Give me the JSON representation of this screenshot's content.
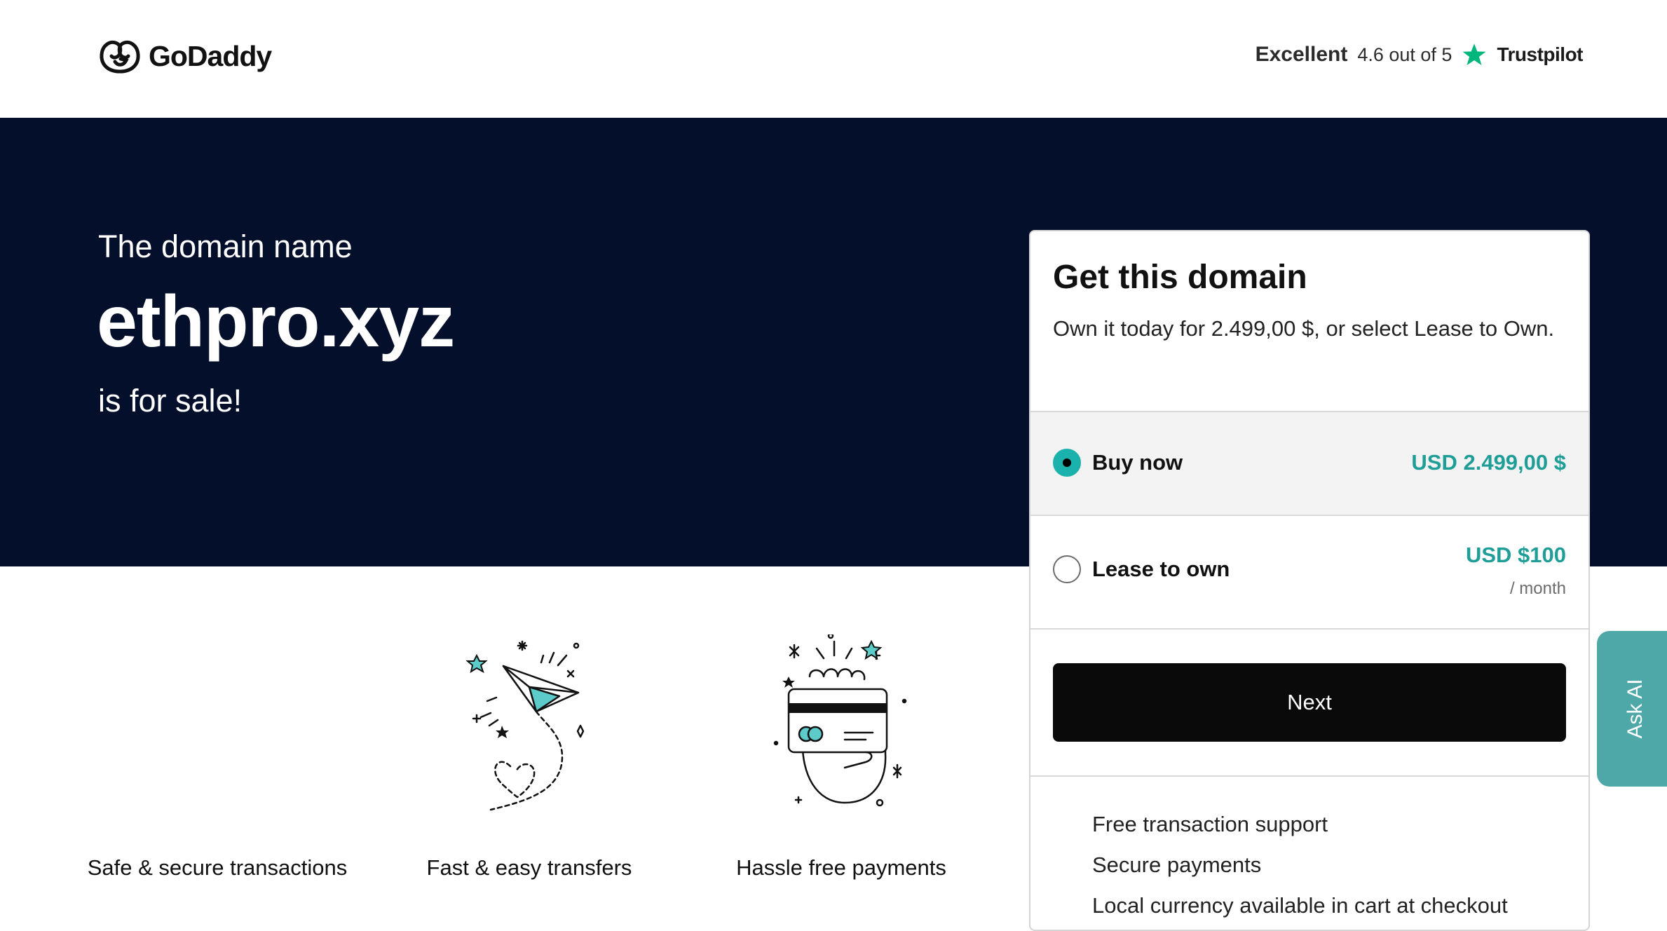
{
  "header": {
    "logo_text": "GoDaddy",
    "trustpilot": {
      "rating_word": "Excellent",
      "score_text": "4.6 out of 5",
      "brand": "Trustpilot",
      "star_color": "#00b67a"
    }
  },
  "hero": {
    "intro": "The domain name",
    "domain": "ethpro.xyz",
    "tail": "is for sale!",
    "background_color": "#030f2b"
  },
  "features": [
    {
      "label": "Safe & secure transactions",
      "icon": "shield-icon"
    },
    {
      "label": "Fast & easy transfers",
      "icon": "paper-plane-icon"
    },
    {
      "label": "Hassle free payments",
      "icon": "credit-card-hand-icon"
    }
  ],
  "purchase_card": {
    "title": "Get this domain",
    "subtitle": "Own it today for 2.499,00 $, or select Lease to Own.",
    "options": [
      {
        "label": "Buy now",
        "price": "USD 2.499,00 $",
        "selected": true
      },
      {
        "label": "Lease to own",
        "price": "USD $100",
        "unit": "/ month",
        "selected": false
      }
    ],
    "next_label": "Next",
    "benefits": [
      "Free transaction support",
      "Secure payments",
      "Local currency available in cart at checkout"
    ],
    "accent_color": "#1bb1ad"
  },
  "ask_ai": {
    "label": "Ask AI",
    "color": "#4ea8a8"
  }
}
